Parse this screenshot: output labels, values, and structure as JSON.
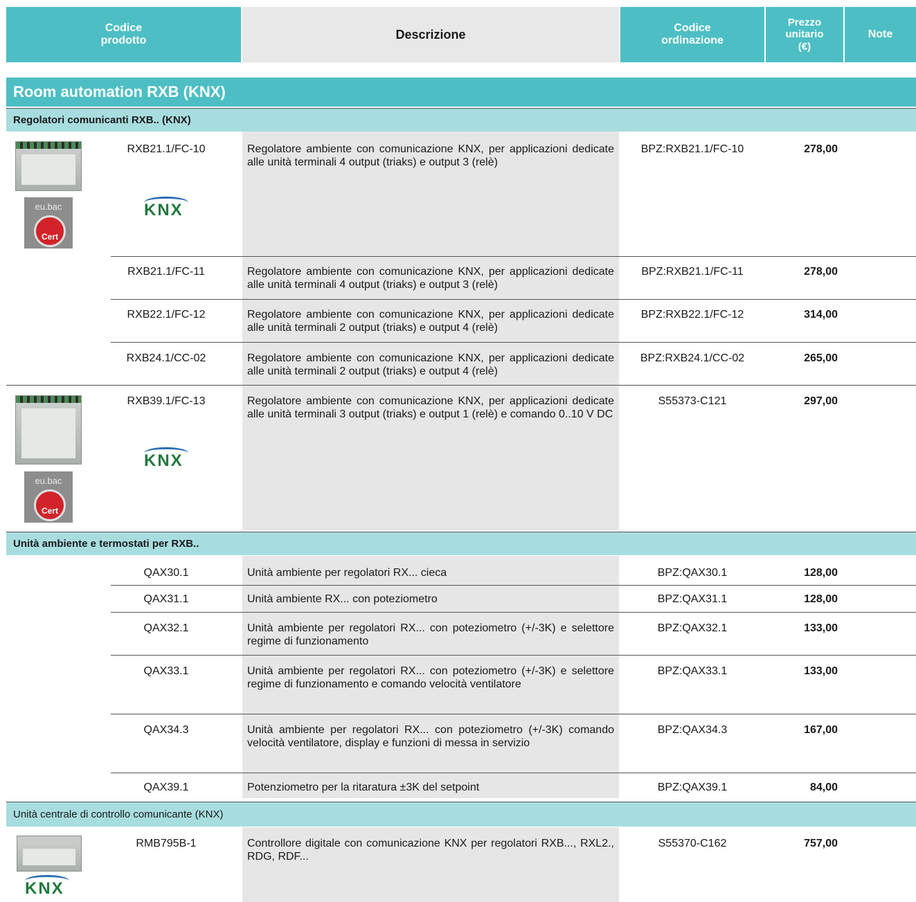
{
  "header": {
    "code_label": [
      "Codice",
      "prodotto"
    ],
    "desc_label": "Descrizione",
    "order_label": [
      "Codice",
      "ordinazione"
    ],
    "price_label": [
      "Prezzo",
      "unitario",
      "(€)"
    ],
    "note_label": "Note"
  },
  "title": "Room automation RXB (KNX)",
  "sections": [
    "Regolatori comunicanti RXB.. (KNX)",
    "Unità ambiente e termostati per RXB..",
    "Unità centrale di controllo comunicante (KNX)"
  ],
  "logos": {
    "knx": "KNX",
    "eubac": "eu.bac",
    "cert": "Cert"
  },
  "rows": [
    {
      "code": "RXB21.1/FC-10",
      "desc": "Regolatore ambiente con comunicazione KNX, per applicazioni dedicate alle unità terminali 4 output (triaks) e output 3 (relè)",
      "order": "BPZ:RXB21.1/FC-10",
      "price": "278,00"
    },
    {
      "code": "RXB21.1/FC-11",
      "desc": "Regolatore ambiente con comunicazione KNX, per applicazioni dedicate alle unità terminali 4 output (triaks) e output 3 (relè)",
      "order": "BPZ:RXB21.1/FC-11",
      "price": "278,00"
    },
    {
      "code": "RXB22.1/FC-12",
      "desc": "Regolatore ambiente con comunicazione KNX, per applicazioni dedicate alle unità terminali 2 output (triaks) e output 4 (relè)",
      "order": "BPZ:RXB22.1/FC-12",
      "price": "314,00"
    },
    {
      "code": "RXB24.1/CC-02",
      "desc": "Regolatore ambiente con comunicazione KNX, per applicazioni dedicate alle unità terminali 2 output (triaks) e output 4 (relè)",
      "order": "BPZ:RXB24.1/CC-02",
      "price": "265,00"
    },
    {
      "code": "RXB39.1/FC-13",
      "desc": "Regolatore ambiente con comunicazione KNX, per applicazioni dedicate alle unità terminali 3 output (triaks) e output 1 (relè) e comando 0..10 V DC",
      "order": "S55373-C121",
      "price": "297,00"
    },
    {
      "code": "QAX30.1",
      "desc": "Unità ambiente per regolatori RX... cieca",
      "order": "BPZ:QAX30.1",
      "price": "128,00"
    },
    {
      "code": "QAX31.1",
      "desc": "Unità ambiente RX... con poteziometro",
      "order": "BPZ:QAX31.1",
      "price": "128,00"
    },
    {
      "code": "QAX32.1",
      "desc": "Unità ambiente per regolatori RX... con poteziometro (+/-3K) e selettore regime di funzionamento",
      "order": "BPZ:QAX32.1",
      "price": "133,00"
    },
    {
      "code": "QAX33.1",
      "desc": "Unità ambiente per regolatori RX... con poteziometro (+/-3K) e selettore regime di funzionamento e comando velocità ventilatore",
      "order": "BPZ:QAX33.1",
      "price": "133,00"
    },
    {
      "code": "QAX34.3",
      "desc": "Unità ambiente per regolatori RX... con poteziometro (+/-3K) comando velocità ventilatore, display e funzioni di messa in servizio",
      "order": "BPZ:QAX34.3",
      "price": "167,00"
    },
    {
      "code": "QAX39.1",
      "desc": "Potenziometro per la ritaratura ±3K del setpoint",
      "order": "BPZ:QAX39.1",
      "price": "84,00"
    },
    {
      "code": "RMB795B-1",
      "desc": "Controllore digitale con comunicazione KNX per regolatori RXB..., RXL2., RDG, RDF...",
      "order": "S55370-C162",
      "price": "757,00"
    }
  ]
}
